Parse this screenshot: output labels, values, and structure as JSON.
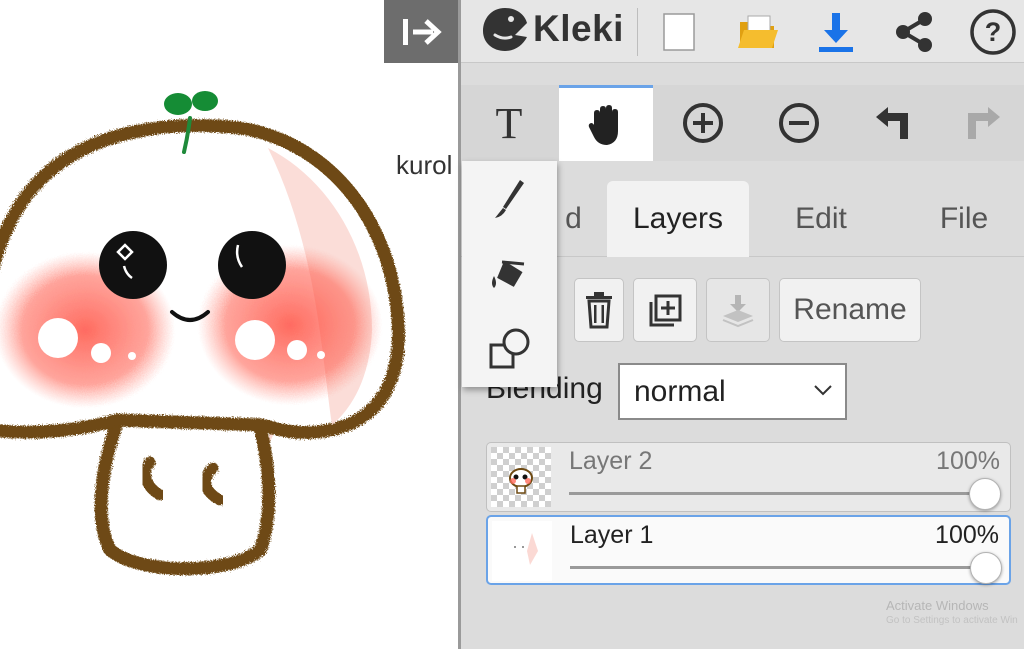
{
  "canvas": {
    "label_text": "kurol"
  },
  "header": {
    "app_name": "Kleki",
    "collapse_icon": "arrow-right-to-bar-icon",
    "actions": [
      {
        "name": "new-image",
        "icon": "blank-page-icon"
      },
      {
        "name": "open-file",
        "icon": "folder-icon"
      },
      {
        "name": "save-download",
        "icon": "download-icon"
      },
      {
        "name": "share",
        "icon": "share-icon"
      },
      {
        "name": "help",
        "icon": "help-icon"
      }
    ]
  },
  "toolbar": {
    "tools": [
      {
        "name": "text",
        "icon": "text-tool-icon",
        "active": false
      },
      {
        "name": "hand",
        "icon": "hand-icon",
        "active": true
      },
      {
        "name": "zoom-in",
        "icon": "zoom-in-icon",
        "active": false
      },
      {
        "name": "zoom-out",
        "icon": "zoom-out-icon",
        "active": false
      },
      {
        "name": "undo",
        "icon": "undo-icon",
        "active": false
      },
      {
        "name": "redo",
        "icon": "redo-icon",
        "active": false
      }
    ],
    "text_glyph": "T"
  },
  "tool_popup": {
    "items": [
      {
        "name": "brush",
        "icon": "brush-icon"
      },
      {
        "name": "paint-bucket",
        "icon": "paint-bucket-icon"
      },
      {
        "name": "shape",
        "icon": "shape-icon"
      }
    ]
  },
  "tabs": {
    "brush_partial": "d",
    "layers": "Layers",
    "edit": "Edit",
    "file": "File",
    "active": "Layers"
  },
  "layer_controls": {
    "rename_label": "Rename",
    "blending_label": "Blending",
    "blending_value": "normal"
  },
  "layers": [
    {
      "name": "Layer 2",
      "opacity_text": "100%",
      "opacity": 1.0,
      "selected": false
    },
    {
      "name": "Layer 1",
      "opacity_text": "100%",
      "opacity": 1.0,
      "selected": true
    }
  ],
  "watermark": {
    "line1": "Activate Windows",
    "line2": "Go to Settings to activate Win"
  },
  "colors": {
    "accent": "#6aa3e8",
    "download_blue": "#1a73e8",
    "folder_yellow": "#f2b21b",
    "panel_bg": "#dcdcdc"
  }
}
